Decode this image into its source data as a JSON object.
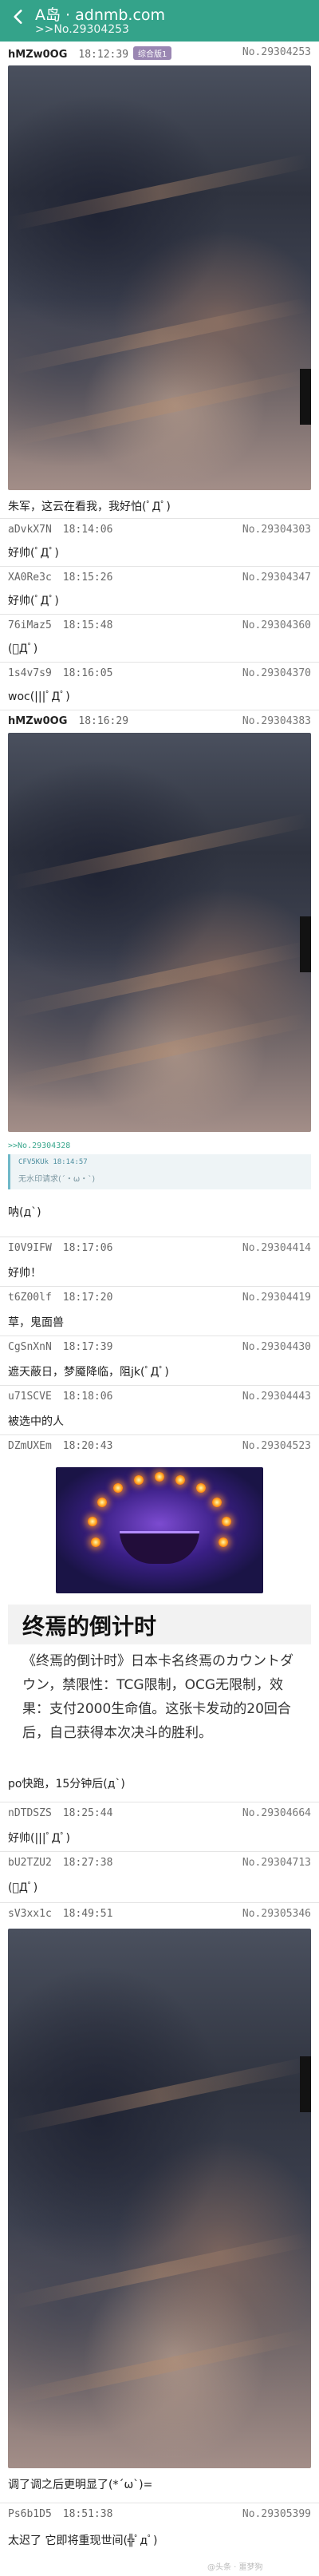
{
  "appbar": {
    "title": "A岛 · adnmb.com",
    "subtitle": ">>No.29304253"
  },
  "posts": [
    {
      "uid": "hMZw0OG",
      "time": "18:12:39",
      "badge": "综合版1",
      "no": "No.29304253",
      "content": "朱军，这云在看我，我好怕(ﾟДﾟ)"
    },
    {
      "uid": "aDvkX7N",
      "time": "18:14:06",
      "no": "No.29304303",
      "content": "好帅(ﾟДﾟ)"
    },
    {
      "uid": "XA0Re3c",
      "time": "18:15:26",
      "no": "No.29304347",
      "content": "好帅(ﾟДﾟ)"
    },
    {
      "uid": "76iMaz5",
      "time": "18:15:48",
      "no": "No.29304360",
      "content": "(ﾟДﾟ)"
    },
    {
      "uid": "1s4v7s9",
      "time": "18:16:05",
      "no": "No.29304370",
      "content": "woc(|||ﾟДﾟ)"
    },
    {
      "uid": "hMZw0OG",
      "time": "18:16:29",
      "no": "No.29304383",
      "content": "呐(д`)"
    },
    {
      "uid": "I0V9IFW",
      "time": "18:17:06",
      "no": "No.29304414",
      "content": "好帅！"
    },
    {
      "uid": "t6Z00lf",
      "time": "18:17:20",
      "no": "No.29304419",
      "content": "草，鬼面兽"
    },
    {
      "uid": "CgSnXnN",
      "time": "18:17:39",
      "no": "No.29304430",
      "content": "遮天蔽日，梦魇降临，阻jk(ﾟДﾟ)"
    },
    {
      "uid": "u71SCVE",
      "time": "18:18:06",
      "no": "No.29304443",
      "content": "被选中的人"
    },
    {
      "uid": "DZmUXEm",
      "time": "18:20:43",
      "no": "No.29304523",
      "content": "po快跑，15分钟后(д`)"
    },
    {
      "uid": "nDTDSZS",
      "time": "18:25:44",
      "no": "No.29304664",
      "content": "好帅(|||ﾟДﾟ)"
    },
    {
      "uid": "bU2TZU2",
      "time": "18:27:38",
      "no": "No.29304713",
      "content": "(ﾟДﾟ)"
    },
    {
      "uid": "sV3xx1c",
      "time": "18:49:51",
      "no": "No.29305346",
      "content": "调了调之后更明显了(*´ω`)="
    },
    {
      "uid": "Ps6b1D5",
      "time": "18:51:38",
      "no": "No.29305399",
      "content": "太迟了 它即将重现世间(╬ﾟдﾟ)"
    }
  ],
  "quote": {
    "ref": ">>No.29304328",
    "meta": "CFV5KUk  18:14:57",
    "text": "无水印请求(´・ω・`)"
  },
  "card": {
    "title": "终焉的倒计时",
    "description": "《终焉的倒计时》日本卡名终焉のカウントダウン，禁限性：TCG限制，OCG无限制，效果：支付2000生命值。这张卡发动的20回合后，自己获得本次决斗的胜利。"
  },
  "watermark": "@头条 · 噩梦狗",
  "colors": {
    "appbar": "#34a38a",
    "badge": "#9a86b2",
    "quote_accent": "#6fb8c8"
  }
}
